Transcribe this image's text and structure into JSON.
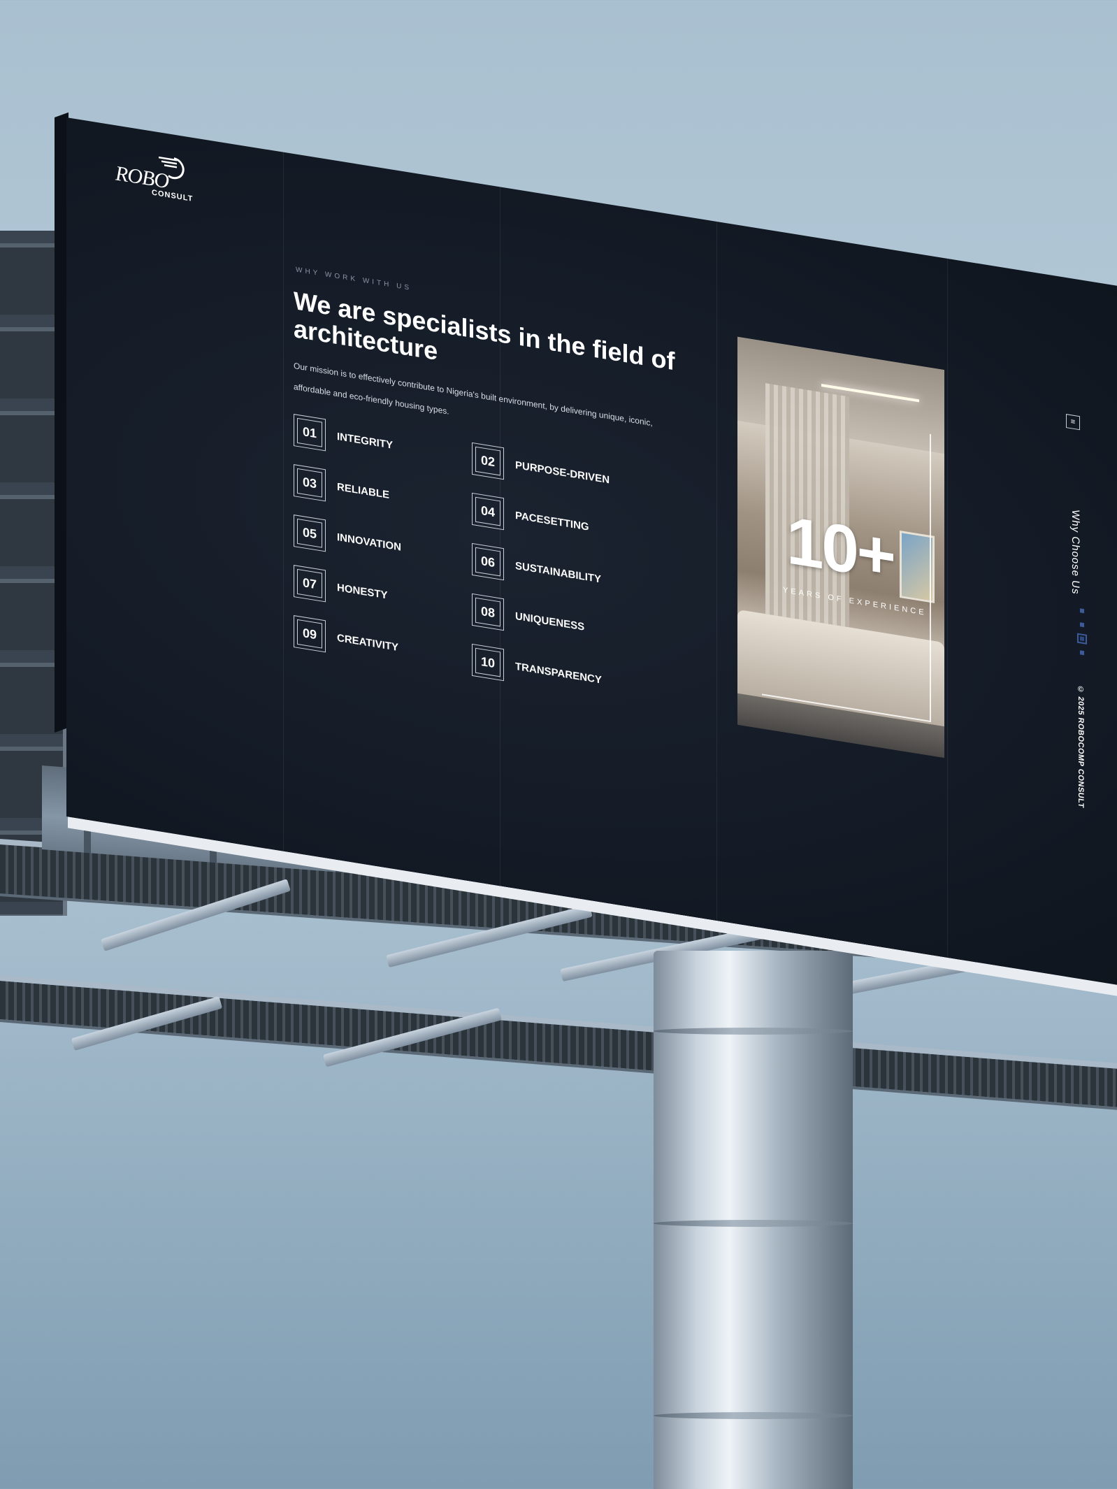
{
  "brand": {
    "name_top": "ROBO",
    "name_bottom": "CONSULT"
  },
  "section": {
    "eyebrow": "WHY WORK WITH US",
    "headline": "We are specialists in the field of architecture",
    "mission": "Our mission is to effectively contribute to Nigeria's built environment, by delivering unique, iconic, affordable and eco-friendly housing types."
  },
  "values": [
    {
      "num": "01",
      "label": "INTEGRITY"
    },
    {
      "num": "02",
      "label": "PURPOSE-DRIVEN"
    },
    {
      "num": "03",
      "label": "RELIABLE"
    },
    {
      "num": "04",
      "label": "PACESETTING"
    },
    {
      "num": "05",
      "label": "INNOVATION"
    },
    {
      "num": "06",
      "label": "SUSTAINABILITY"
    },
    {
      "num": "07",
      "label": "HONESTY"
    },
    {
      "num": "08",
      "label": "UNIQUENESS"
    },
    {
      "num": "09",
      "label": "CREATIVITY"
    },
    {
      "num": "10",
      "label": "TRANSPARENCY"
    }
  ],
  "stat": {
    "value": "10+",
    "caption": "YEARS OF EXPERIENCE"
  },
  "side": {
    "menu_icon": "hamburger-icon",
    "title": "Why Choose Us",
    "copyright": "© 2025 ROBOCOMP CONSULT",
    "active_dot": 3
  },
  "colors": {
    "board": "#141b26",
    "accent": "#3c5b9a",
    "sky": "#a9c0d0"
  }
}
